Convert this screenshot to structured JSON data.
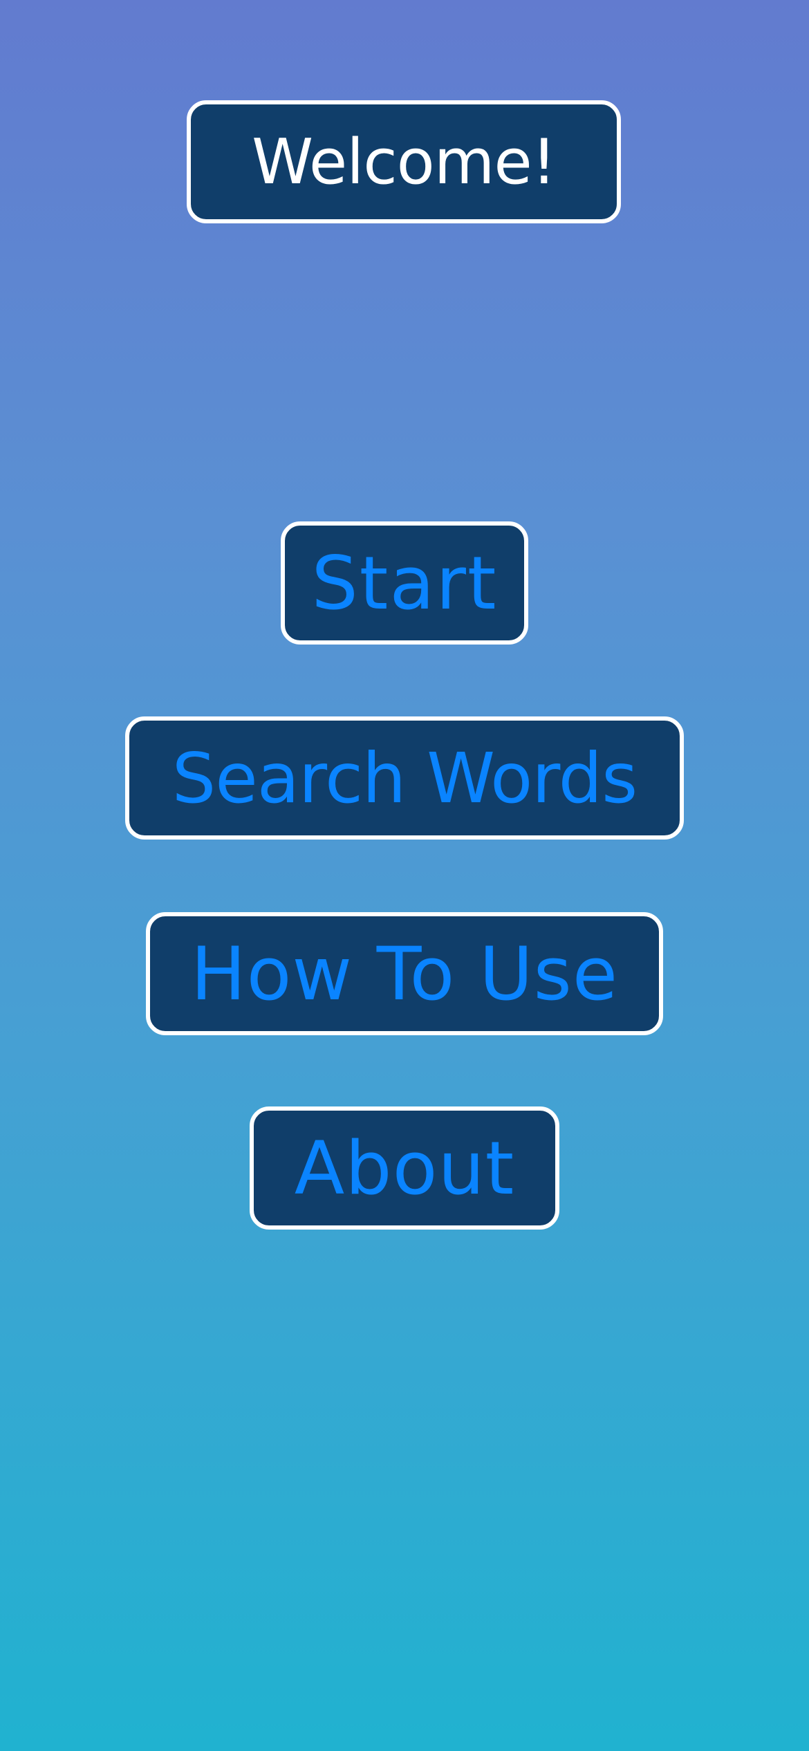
{
  "header": {
    "title": "Welcome!"
  },
  "menu": {
    "start_label": "Start",
    "search_words_label": "Search Words",
    "how_to_use_label": "How To Use",
    "about_label": "About"
  },
  "colors": {
    "button_background": "#103e6a",
    "button_border": "#ffffff",
    "button_text": "#0a84ff",
    "title_text": "#ffffff",
    "gradient_top": "#627bcf",
    "gradient_bottom": "#20b2d0"
  }
}
